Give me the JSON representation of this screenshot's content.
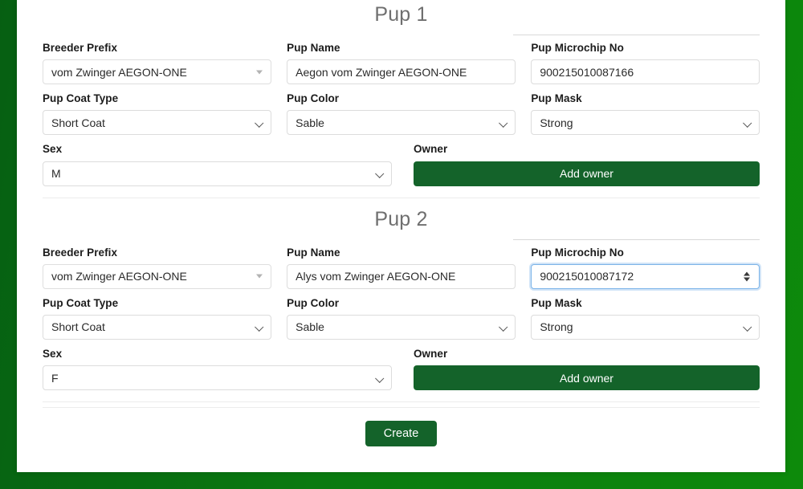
{
  "theme": {
    "accent_green": "#14632a",
    "bg_green": "#0d8a0b",
    "focus_blue": "#7ab3e8",
    "heading_gray": "#6f6f6f"
  },
  "labels": {
    "breeder_prefix": "Breeder Prefix",
    "pup_name": "Pup Name",
    "pup_microchip_no": "Pup Microchip No",
    "pup_coat_type": "Pup Coat Type",
    "pup_color": "Pup Color",
    "pup_mask": "Pup Mask",
    "sex": "Sex",
    "owner": "Owner"
  },
  "pups": [
    {
      "title": "Pup 1",
      "breeder_prefix": "vom Zwinger AEGON-ONE",
      "pup_name": "Aegon vom Zwinger AEGON-ONE",
      "microchip_no": "900215010087166",
      "coat_type": "Short Coat",
      "color": "Sable",
      "mask": "Strong",
      "sex": "M",
      "add_owner_label": "Add owner",
      "microchip_focused": false
    },
    {
      "title": "Pup 2",
      "breeder_prefix": "vom Zwinger AEGON-ONE",
      "pup_name": "Alys vom Zwinger AEGON-ONE",
      "microchip_no": "900215010087172",
      "coat_type": "Short Coat",
      "color": "Sable",
      "mask": "Strong",
      "sex": "F",
      "add_owner_label": "Add owner",
      "microchip_focused": true
    }
  ],
  "footer": {
    "create_label": "Create"
  }
}
